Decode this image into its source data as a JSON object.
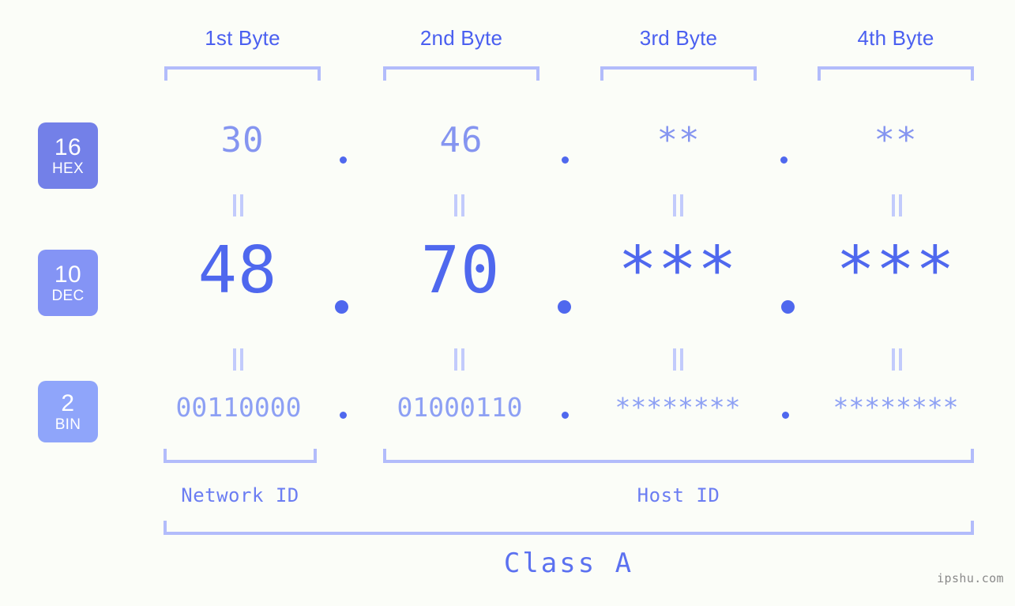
{
  "meta": {
    "background_color": "#fbfdf8",
    "accent_strong": "#4a5ff0",
    "accent_mid": "#8494f5",
    "accent_light": "#b2bcfb"
  },
  "byte_headers": [
    {
      "label": "1st Byte"
    },
    {
      "label": "2nd Byte"
    },
    {
      "label": "3rd Byte"
    },
    {
      "label": "4th Byte"
    }
  ],
  "bases": [
    {
      "number": "16",
      "name": "HEX",
      "color": "#7380e8"
    },
    {
      "number": "10",
      "name": "DEC",
      "color": "#8494f5"
    },
    {
      "number": "2",
      "name": "BIN",
      "color": "#8fa5fa"
    }
  ],
  "rows": {
    "hex": {
      "base_number": "16",
      "base_name": "HEX",
      "values": [
        "30",
        "46",
        "**",
        "**"
      ],
      "separator": "."
    },
    "dec": {
      "base_number": "10",
      "base_name": "DEC",
      "values": [
        "48",
        "70",
        "***",
        "***"
      ],
      "separator": "."
    },
    "bin": {
      "base_number": "2",
      "base_name": "BIN",
      "values": [
        "00110000",
        "01000110",
        "********",
        "********"
      ],
      "separator": "."
    }
  },
  "equals_marks": [
    "=",
    "=",
    "=",
    "=",
    "=",
    "=",
    "=",
    "="
  ],
  "sections": {
    "network_id": "Network ID",
    "host_id": "Host ID",
    "class": "Class A"
  },
  "watermark": "ipshu.com"
}
